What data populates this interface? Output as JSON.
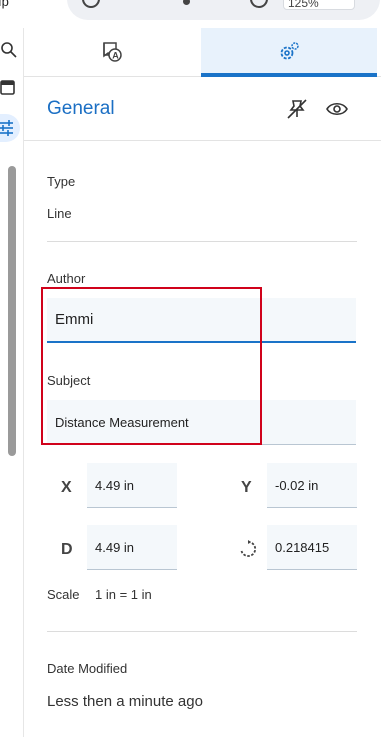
{
  "top": {
    "left_text": "ıp",
    "zoom_value": "125%"
  },
  "icons": {
    "rail": [
      "search-icon",
      "panel-icon",
      "properties-icon"
    ],
    "tabs": [
      "annotation-icon",
      "settings-gear-icon"
    ],
    "header": [
      "unpin-icon",
      "eye-icon"
    ],
    "rotation": "rotate-icon"
  },
  "colors": {
    "accent": "#1a73c8",
    "title": "#1b6fc4",
    "highlight_box": "#d0021b",
    "field_bg": "#f4f8fb",
    "active_tab_bg": "#e8f2fc"
  },
  "section": {
    "title": "General"
  },
  "type": {
    "label": "Type",
    "value": "Line"
  },
  "author": {
    "label": "Author",
    "value": "Emmi"
  },
  "subject": {
    "label": "Subject",
    "value": "Distance Measurement"
  },
  "coords": {
    "x_label": "X",
    "x_value": "4.49 in",
    "y_label": "Y",
    "y_value": "-0.02 in",
    "d_label": "D",
    "d_value": "4.49 in",
    "rotation_value": "0.218415"
  },
  "scale": {
    "label": "Scale",
    "value": "1 in = 1 in"
  },
  "date_modified": {
    "label": "Date Modified",
    "value": "Less then a minute ago"
  }
}
